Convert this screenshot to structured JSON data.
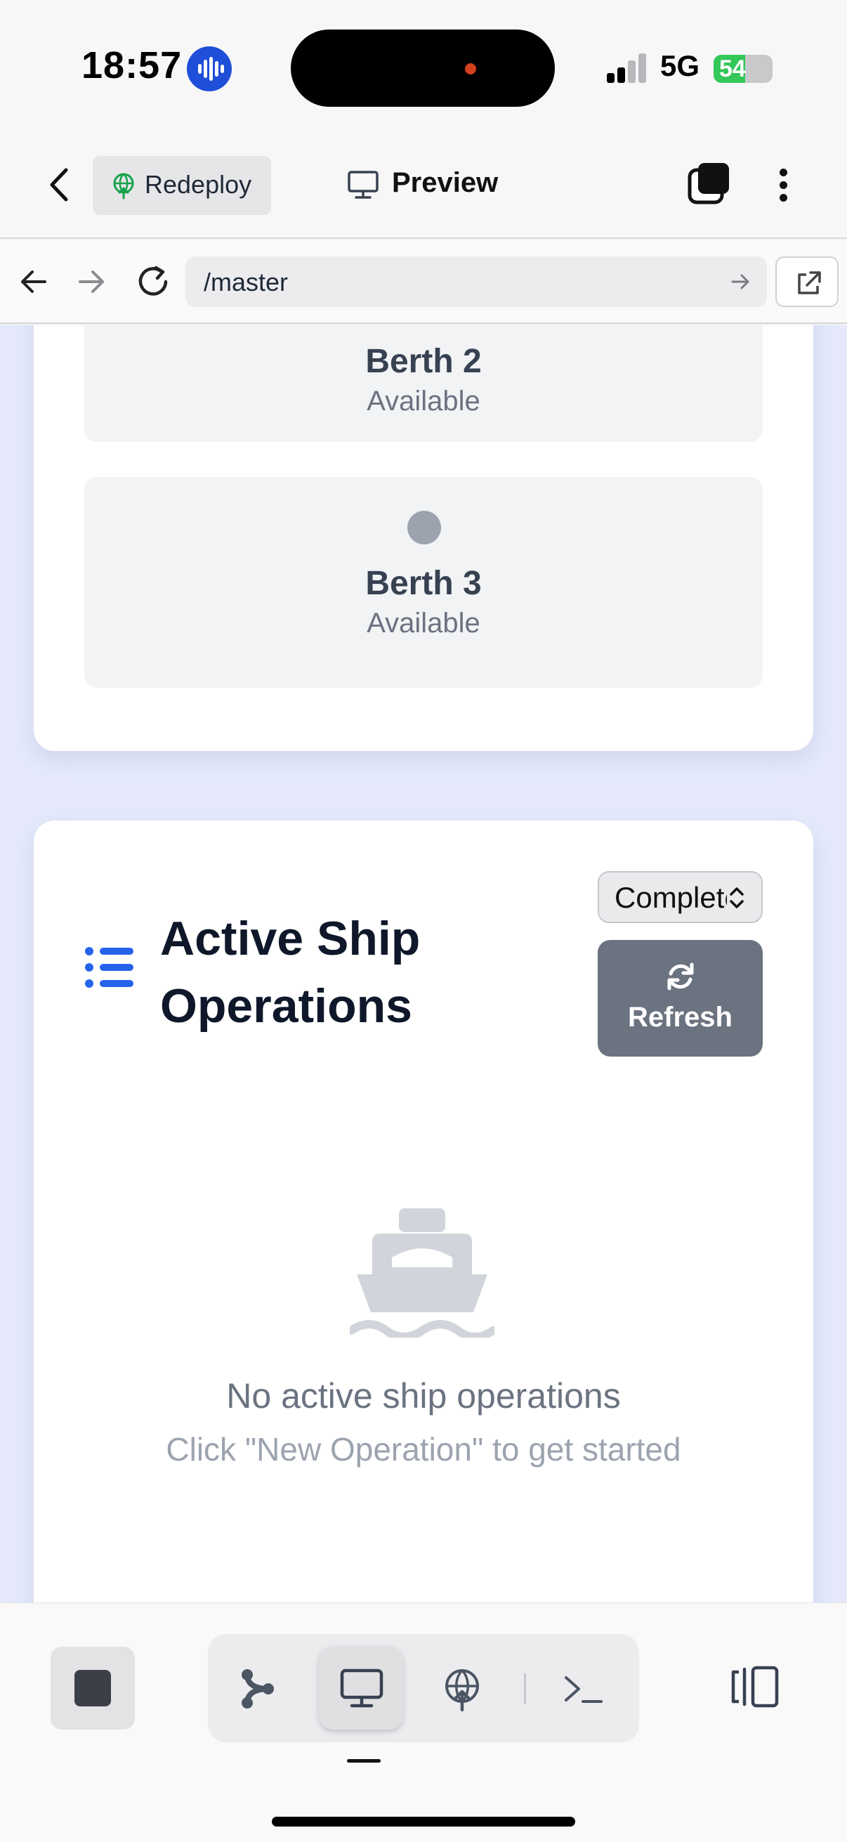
{
  "status_bar": {
    "time": "18:57",
    "network": "5G",
    "battery_level": "54",
    "signal_bars_active": 2,
    "signal_bars_total": 4
  },
  "header": {
    "redeploy_label": "Redeploy",
    "preview_label": "Preview"
  },
  "browser": {
    "url": "/master"
  },
  "berths": [
    {
      "name": "Berth 2",
      "status": "Available"
    },
    {
      "name": "Berth 3",
      "status": "Available"
    }
  ],
  "operations": {
    "title": "Active Ship Operations",
    "filter_value": "Completed",
    "refresh_label": "Refresh",
    "empty_title": "No active ship operations",
    "empty_subtitle": "Click \"New Operation\" to get started"
  },
  "colors": {
    "accent_blue": "#2563eb",
    "page_background": "#e5e9fb",
    "refresh_button": "#6b7280",
    "battery_green": "#34c759",
    "redeploy_icon_green": "#16a34a"
  },
  "toolbar": {
    "icons": [
      "stop-icon",
      "git-branch-icon",
      "monitor-icon",
      "deploy-globe-icon",
      "terminal-icon",
      "layout-panels-icon"
    ],
    "active_tool": "monitor-icon"
  }
}
